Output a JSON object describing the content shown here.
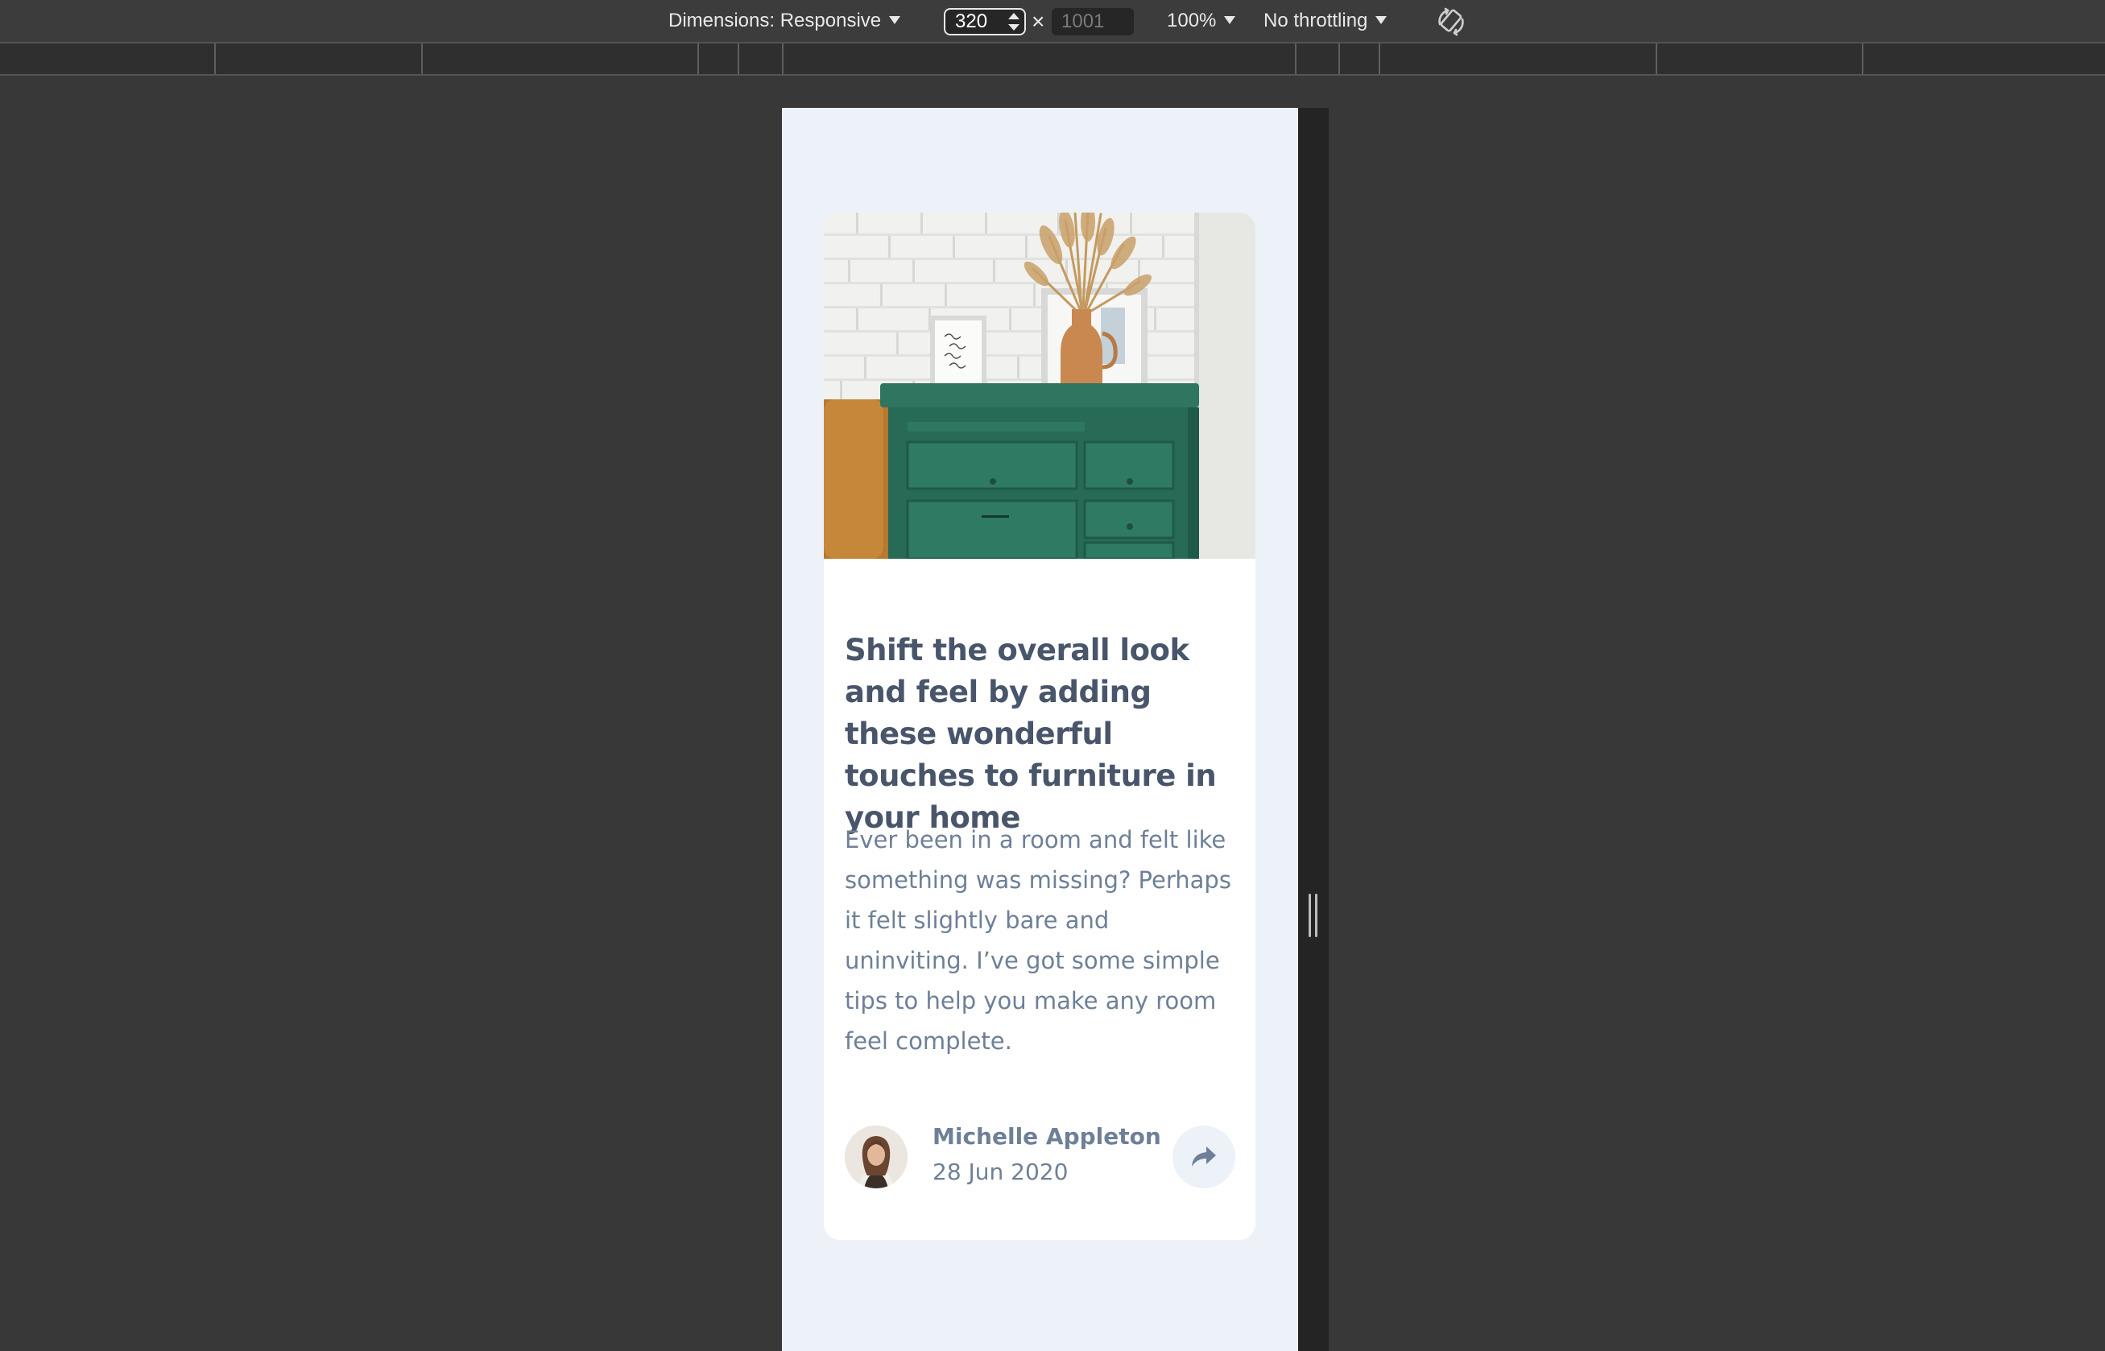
{
  "devtools": {
    "dimensions_label": "Dimensions: Responsive",
    "width_value": "320",
    "height_placeholder": "1001",
    "times_symbol": "×",
    "zoom_label": "100%",
    "throttling_label": "No throttling",
    "icons": {
      "rotate": "rotate-icon",
      "dropdown": "caret-down-icon"
    }
  },
  "card": {
    "image_alt": "Green drawer with vase of dried grass and framed prints against a white brick wall",
    "title": "Shift the overall look and feel by adding these wonderful touches to furniture in your home",
    "description": "Ever been in a room and felt like something was missing? Perhaps it felt slightly bare and uninviting. I’ve got some simple tips to help you make any room feel complete.",
    "author": {
      "name": "Michelle Appleton",
      "date": "28 Jun 2020",
      "avatar_alt": "Michelle Appleton avatar"
    },
    "share_icon": "share-icon"
  },
  "colors": {
    "page_background": "#edf2f8",
    "card_background": "#ffffff",
    "title_text": "#48556a",
    "body_text": "#6e8098",
    "share_button_bg": "#ecf2f8"
  }
}
